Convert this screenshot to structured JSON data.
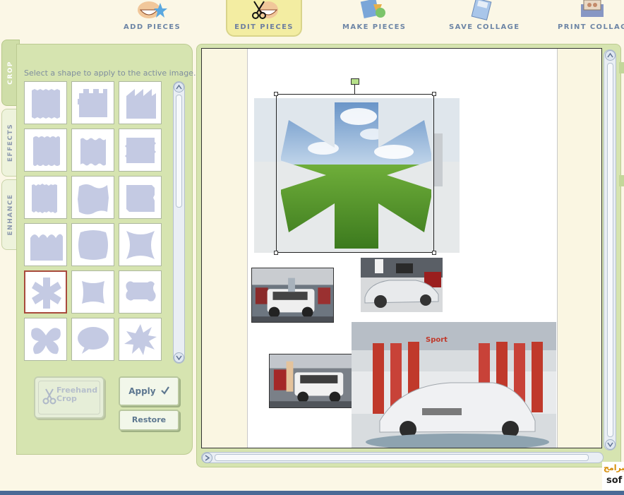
{
  "toolbar": {
    "items": [
      {
        "label": "ADD PIECES",
        "icon": "add-pieces-icon"
      },
      {
        "label": "EDIT PIECES",
        "icon": "edit-pieces-icon",
        "active": true
      },
      {
        "label": "MAKE PIECES",
        "icon": "make-pieces-icon"
      },
      {
        "label": "SAVE COLLAGE",
        "icon": "save-collage-icon"
      },
      {
        "label": "PRINT COLLAGE",
        "icon": "print-collage-icon"
      }
    ]
  },
  "side_tabs": [
    {
      "label": "CROP",
      "active": true
    },
    {
      "label": "EFFECTS",
      "active": false
    },
    {
      "label": "ENHANCE",
      "active": false
    }
  ],
  "crop_panel": {
    "instruction": "Select a shape to apply to the active image.",
    "shapes": [
      "deckle-edge",
      "castle-edge",
      "sawtooth-edge",
      "scalloped-edge",
      "wavy-edge",
      "torn-edge",
      "rough-edge",
      "wobbly-edge",
      "ripped-edge",
      "wave-top",
      "bubble-rect",
      "pinched-square",
      "asterisk",
      "pillow",
      "bone",
      "butterfly",
      "speech-bubble",
      "starburst"
    ],
    "selected_shape": "asterisk",
    "freehand_label_line1": "Freehand",
    "freehand_label_line2": "Crop",
    "apply_label": "Apply",
    "apply_icon": "checkmark-icon",
    "restore_label": "Restore"
  },
  "colors": {
    "panel_green": "#d6e4b0",
    "shape_fill": "#c4cae3",
    "selection_border": "#a84a3c",
    "background_cream": "#fbf7e6"
  },
  "watermark": {
    "line1": "البرامج",
    "line2": "sof"
  }
}
